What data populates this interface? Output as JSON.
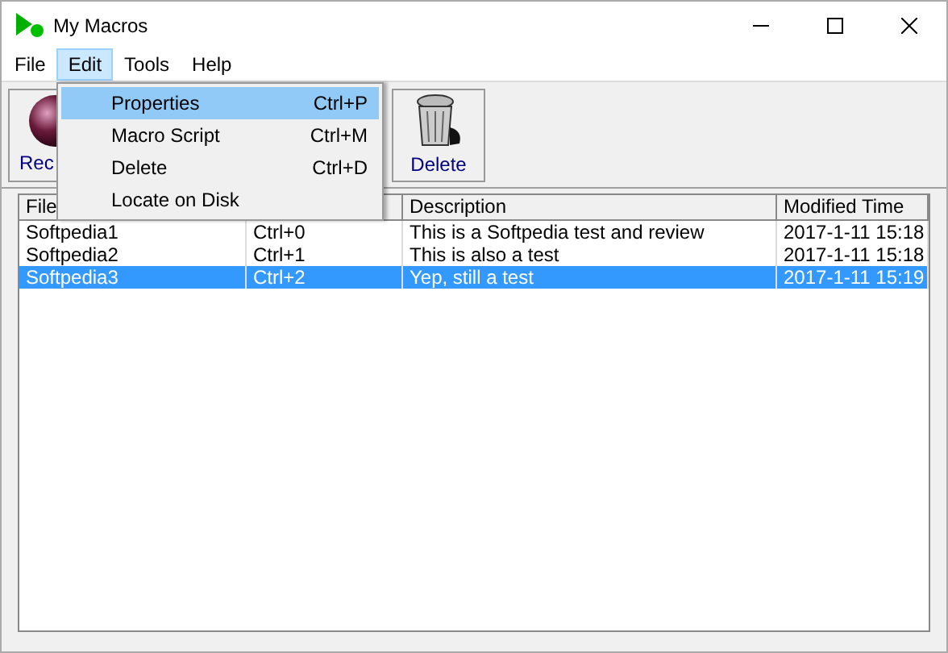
{
  "window": {
    "title": "My Macros"
  },
  "menu_bar": [
    {
      "label": "File",
      "selected": false
    },
    {
      "label": "Edit",
      "selected": true
    },
    {
      "label": "Tools",
      "selected": false
    },
    {
      "label": "Help",
      "selected": false
    }
  ],
  "toolbar": [
    {
      "kind": "record",
      "label": "Rec"
    },
    {
      "kind": "delete",
      "label": "Delete"
    }
  ],
  "dropdown_menu": [
    {
      "label": "Properties",
      "shortcut": "Ctrl+P",
      "selected": true
    },
    {
      "label": "Macro Script",
      "shortcut": "Ctrl+M",
      "selected": false
    },
    {
      "label": "Delete",
      "shortcut": "Ctrl+D",
      "selected": false
    },
    {
      "label": "Locate on Disk",
      "selected": false
    }
  ],
  "table": {
    "columns": [
      "File",
      "",
      "Description",
      "Modified Time"
    ],
    "rows": [
      {
        "cells": [
          "Softpedia1",
          "Ctrl+0",
          "This is a Softpedia test and review",
          "2017-1-11 15:18"
        ],
        "selected": false
      },
      {
        "cells": [
          "Softpedia2",
          "Ctrl+1",
          "This is also a test",
          "2017-1-11 15:18"
        ],
        "selected": false
      },
      {
        "cells": [
          "Softpedia3",
          "Ctrl+2",
          "Yep, still a test",
          "2017-1-11 15:19"
        ],
        "selected": true
      }
    ]
  }
}
